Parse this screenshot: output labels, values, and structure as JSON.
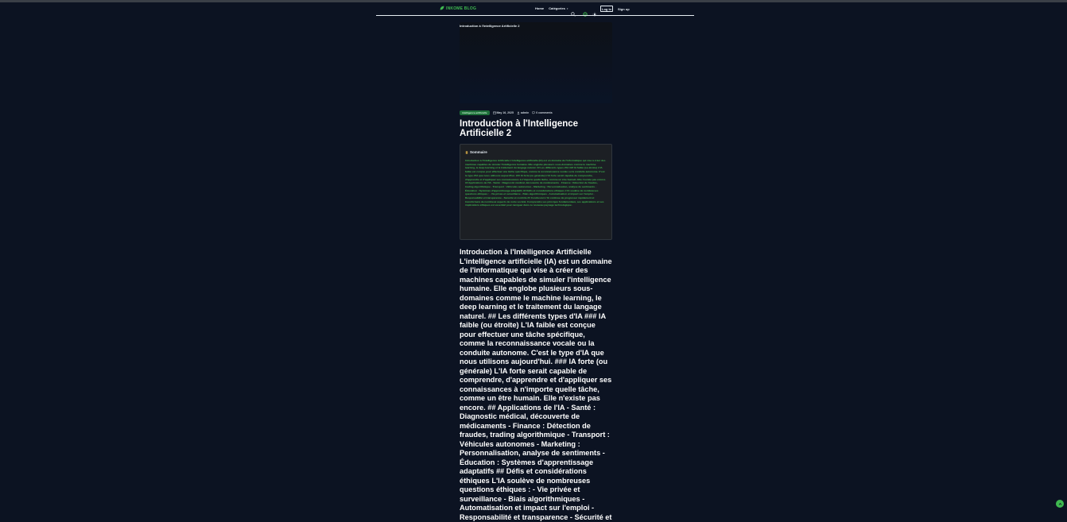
{
  "nav": {
    "brand": "INKOME BLOG",
    "items": [
      {
        "label": "Home"
      },
      {
        "label": "Catégories"
      }
    ],
    "login": "Log in",
    "signup": "Sign up"
  },
  "article": {
    "hero_caption": "Introduction à l'Intelligence Artificielle 2",
    "tag": "intelligence-artificielle",
    "date": "May 16, 2025",
    "author": "admin",
    "comments": "0 comments",
    "title": "Introduction à l'Intelligence Artificielle 2",
    "summary_heading": "Sommaire",
    "summary": "Introduction à l'Intelligence Artificielle L'intelligence artificielle (IA) est un domaine de l'informatique qui vise à créer des machines capables de simuler l'intelligence humaine. Elle englobe plusieurs sous-domaines comme le machine learning, le deep learning et le traitement du langage naturel. ## Les différents types d'IA ### IA faible (ou étroite) L'IA faible est conçue pour effectuer une tâche spécifique, comme la reconnaissance vocale ou la conduite autonome. C'est le type d'IA que nous utilisons aujourd'hui. ### IA forte (ou générale) L'IA forte serait capable de comprendre, d'apprendre et d'appliquer ses connaissances à n'importe quelle tâche, comme un être humain. Elle n'existe pas encore. ## Applications de l'IA - Santé : Diagnostic médical, découverte de médicaments - Finance : Détection de fraudes, trading algorithmique - Transport : Véhicules autonomes - Marketing : Personnalisation, analyse de sentiments - Éducation : Systèmes d'apprentissage adaptatifs ## Défis et considérations éthiques L'IA soulève de nombreuses questions éthiques : - Vie privée et surveillance - Biais algorithmiques - Automatisation et impact sur l'emploi - Responsabilité et transparence - Sécurité et contrôle ## Conclusion L'IA continue de progresser rapidement et transformera de nombreux aspects de notre société. Comprendre ses principes fondamentaux, ses applications et ses implications éthiques est essentiel pour naviguer dans ce nouveau paysage technologique.",
    "body": "Introduction à l'Intelligence Artificielle L'intelligence artificielle (IA) est un domaine de l'informatique qui vise à créer des machines capables de simuler l'intelligence humaine. Elle englobe plusieurs sous-domaines comme le machine learning, le deep learning et le traitement du langage naturel. ## Les différents types d'IA ### IA faible (ou étroite) L'IA faible est conçue pour effectuer une tâche spécifique, comme la reconnaissance vocale ou la conduite autonome. C'est le type d'IA que nous utilisons aujourd'hui. ### IA forte (ou générale) L'IA forte serait capable de comprendre, d'apprendre et d'appliquer ses connaissances à n'importe quelle tâche, comme un être humain. Elle n'existe pas encore. ## Applications de l'IA - Santé : Diagnostic médical, découverte de médicaments - Finance : Détection de fraudes, trading algorithmique - Transport : Véhicules autonomes - Marketing : Personnalisation, analyse de sentiments - Éducation : Systèmes d'apprentissage adaptatifs ## Défis et considérations éthiques L'IA soulève de nombreuses questions éthiques : - Vie privée et surveillance - Biais algorithmiques - Automatisation et impact sur l'emploi - Responsabilité et transparence - Sécurité et"
  },
  "colors": {
    "background": "#0c1322",
    "accent": "#3fb950",
    "tag_bg": "#1f6f3a",
    "summary_bg": "#1c1f24"
  },
  "icons": [
    "leaf-icon",
    "search-icon",
    "globe-icon",
    "sun-icon",
    "calendar-icon",
    "user-icon",
    "comment-icon",
    "document-icon",
    "chevron-up-icon"
  ]
}
